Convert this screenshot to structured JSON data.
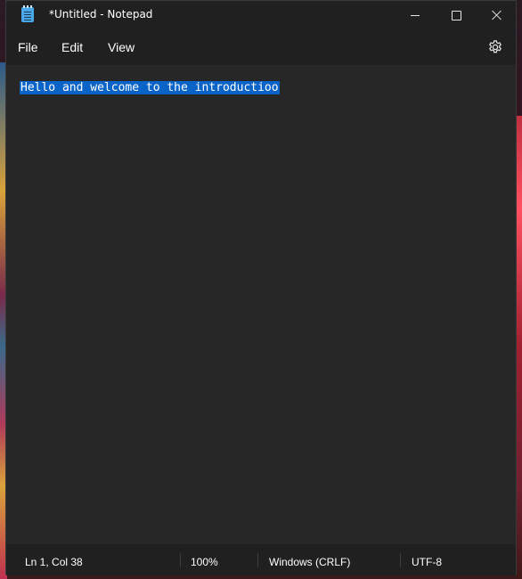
{
  "window": {
    "title": "*Untitled - Notepad",
    "app_icon": "notepad-icon"
  },
  "window_controls": {
    "minimize_icon": "minimize-icon",
    "maximize_icon": "maximize-icon",
    "close_icon": "close-icon"
  },
  "menu": {
    "items": [
      {
        "label": "File"
      },
      {
        "label": "Edit"
      },
      {
        "label": "View"
      }
    ],
    "settings_icon": "gear-icon"
  },
  "editor": {
    "text": "Hello and welcome to the introductioo",
    "selected": true,
    "selection_color": "#0a64c8"
  },
  "status": {
    "position": "Ln 1, Col 38",
    "zoom": "100%",
    "line_ending": "Windows (CRLF)",
    "encoding": "UTF-8"
  }
}
